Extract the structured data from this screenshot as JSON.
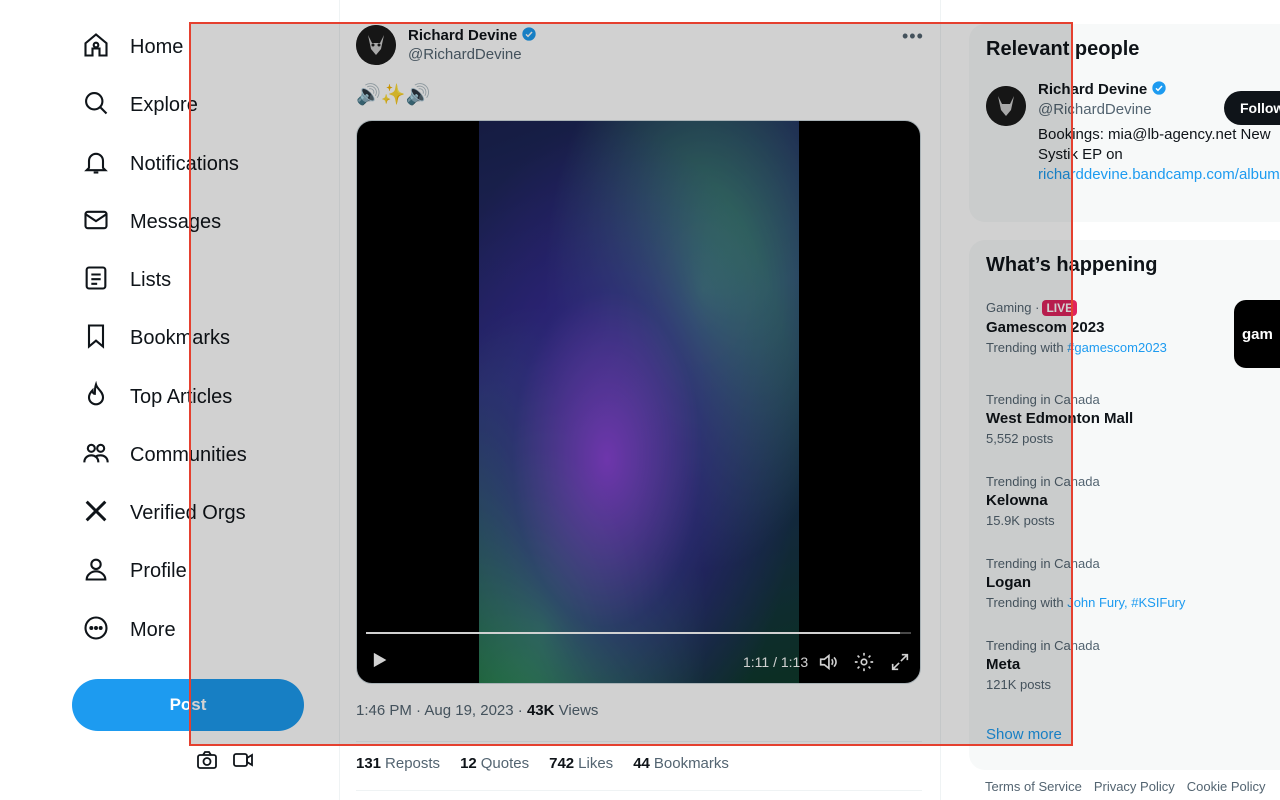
{
  "nav": {
    "items": [
      {
        "label": "Home",
        "icon": "home-icon"
      },
      {
        "label": "Explore",
        "icon": "search-icon"
      },
      {
        "label": "Notifications",
        "icon": "bell-icon"
      },
      {
        "label": "Messages",
        "icon": "envelope-icon"
      },
      {
        "label": "Lists",
        "icon": "list-icon"
      },
      {
        "label": "Bookmarks",
        "icon": "bookmark-icon"
      },
      {
        "label": "Top Articles",
        "icon": "flame-icon"
      },
      {
        "label": "Communities",
        "icon": "people-icon"
      },
      {
        "label": "Verified Orgs",
        "icon": "x-logo-icon"
      },
      {
        "label": "Profile",
        "icon": "person-icon"
      },
      {
        "label": "More",
        "icon": "more-circle-icon"
      }
    ],
    "post_label": "Post"
  },
  "tweet": {
    "author_name": "Richard Devine",
    "author_handle": "@RichardDevine",
    "text": "🔊✨🔊",
    "video": {
      "time": "1:11 / 1:13",
      "progress": 0.98
    },
    "timestamp": "1:46 PM · Aug 19, 2023",
    "dot": "·",
    "views_count": "43K",
    "views_label": "Views",
    "stats": [
      {
        "count": "131",
        "label": "Reposts"
      },
      {
        "count": "12",
        "label": "Quotes"
      },
      {
        "count": "742",
        "label": "Likes"
      },
      {
        "count": "44",
        "label": "Bookmarks"
      }
    ]
  },
  "relevant_people": {
    "title": "Relevant people",
    "name": "Richard Devine",
    "handle": "@RichardDevine",
    "bio_text": "Bookings: mia@lb-agency.net New Systik EP on",
    "bio_link": "richarddevine.bandcamp.com/album/systik",
    "follow_label": "Follow"
  },
  "happening": {
    "title": "What’s happening",
    "trends": [
      {
        "context": "Gaming ·",
        "live": "LIVE",
        "title": "Gamescom 2023",
        "sub_prefix": "Trending with",
        "sub_links": "#gamescom2023",
        "thumb": "gam"
      },
      {
        "context": "Trending in Canada",
        "title": "West Edmonton Mall",
        "sub": "5,552 posts"
      },
      {
        "context": "Trending in Canada",
        "title": "Kelowna",
        "sub": "15.9K posts"
      },
      {
        "context": "Trending in Canada",
        "title": "Logan",
        "sub_prefix": "Trending with",
        "sub_links": "John Fury, #KSIFury"
      },
      {
        "context": "Trending in Canada",
        "title": "Meta",
        "sub": "121K posts"
      }
    ],
    "show_more": "Show more"
  },
  "footer": {
    "links": [
      "Terms of Service",
      "Privacy Policy",
      "Cookie Policy"
    ]
  }
}
